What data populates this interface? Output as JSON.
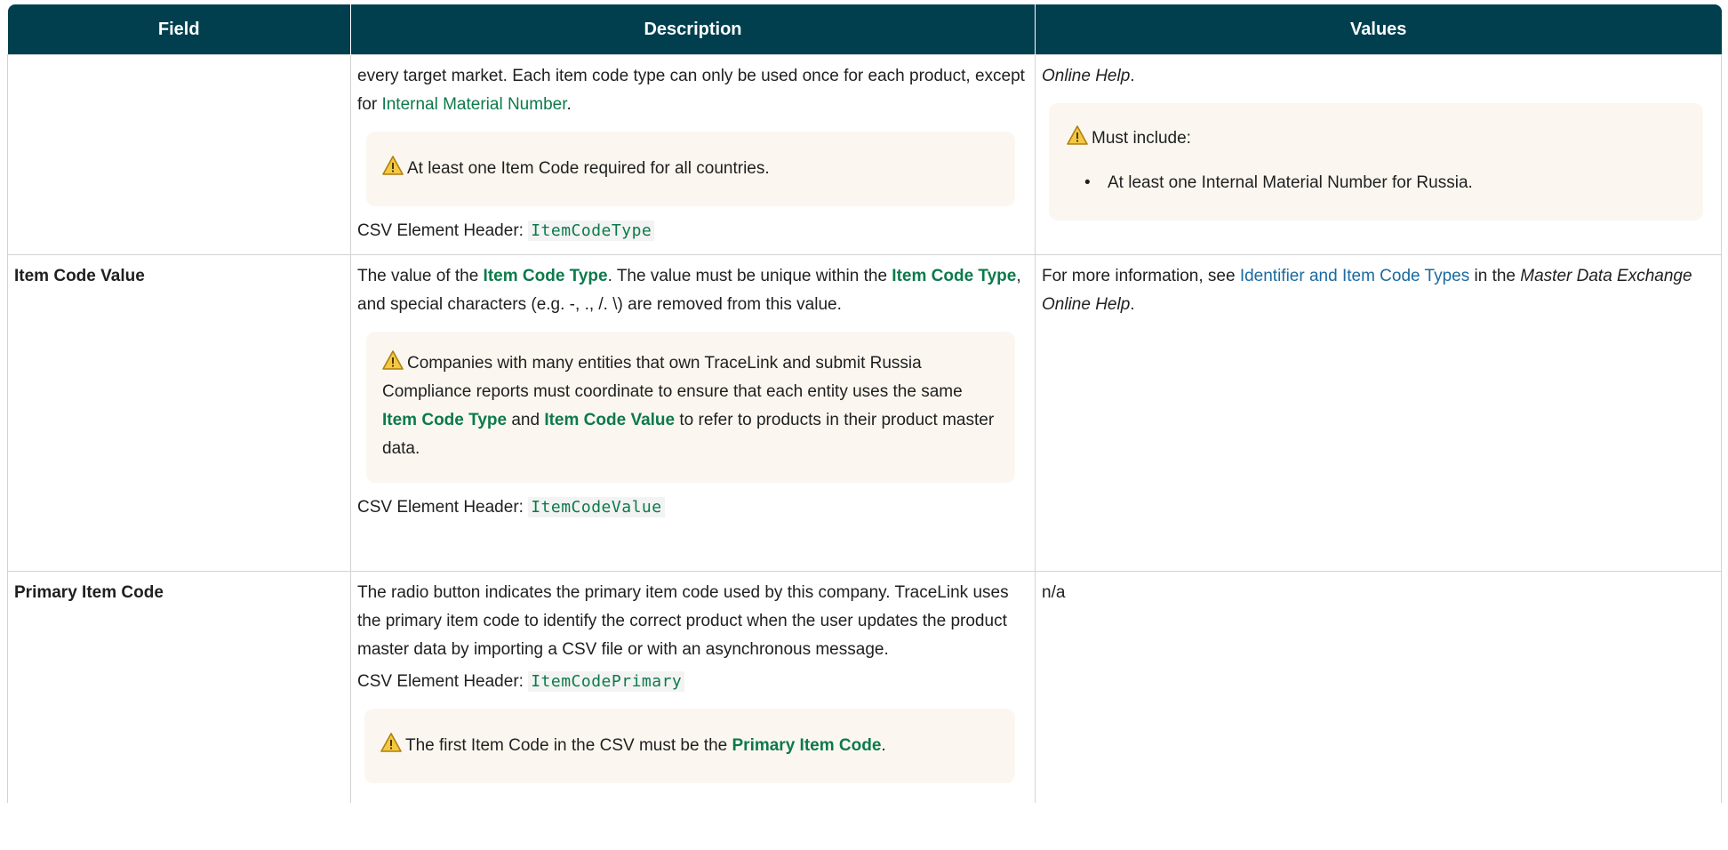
{
  "table": {
    "headers": [
      "Field",
      "Description",
      "Values"
    ],
    "rows": [
      {
        "field": "",
        "description_parts": [
          "every target market. Each item code type can only be used once for each product, except for ",
          "Internal Material Number",
          "."
        ],
        "note": "At least one Item Code required for all countries.",
        "csv_label": "CSV Element Header:",
        "csv_code": "ItemCodeType",
        "values_text": "Online Help",
        "values_text_end": ".",
        "values_note_title": "Must include:",
        "values_note_items": [
          "At least one Internal Material Number for Russia."
        ]
      },
      {
        "field": "Item Code Value",
        "desc_a": "The value of the ",
        "desc_link1": "Item Code Type",
        "desc_b": ". The value must be unique within the ",
        "desc_link2": "Item Code Type",
        "desc_c": ", and special characters (e.g. -, ., /. \\) are removed from this value.",
        "note_a": "Companies with many entities that own TraceLink and submit Russia Compliance reports must coordinate to ensure that each entity uses the same ",
        "note_link1": "Item Code Type",
        "note_b": " and ",
        "note_link2": "Item Code Value",
        "note_c": " to refer to products in their product master data.",
        "csv_label": "CSV Element Header:",
        "csv_code": "ItemCodeValue",
        "values_a": "For more information, see ",
        "values_link": "Identifier and Item Code Types",
        "values_b": " in the ",
        "values_italic": "Master Data Exchange Online Help",
        "values_c": "."
      },
      {
        "field": "Primary Item Code",
        "description": " The radio button indicates the primary item code used by this company. TraceLink uses the primary item code to identify the correct product when the user updates the product master data by importing a CSV file or with an asynchronous message.",
        "csv_label": "CSV Element Header:",
        "csv_code": "ItemCodePrimary",
        "note_a": "The first Item Code in the CSV must be the ",
        "note_link": "Primary Item Code",
        "note_b": ".",
        "values": "n/a"
      }
    ]
  },
  "colors": {
    "header_bg": "#013f4f",
    "link_green": "#0c7a4a",
    "link_blue": "#1a6aa0",
    "note_bg": "#fbf7f0",
    "warning": "#d9a21b"
  },
  "icons": {
    "warning": "warning-triangle-icon"
  }
}
